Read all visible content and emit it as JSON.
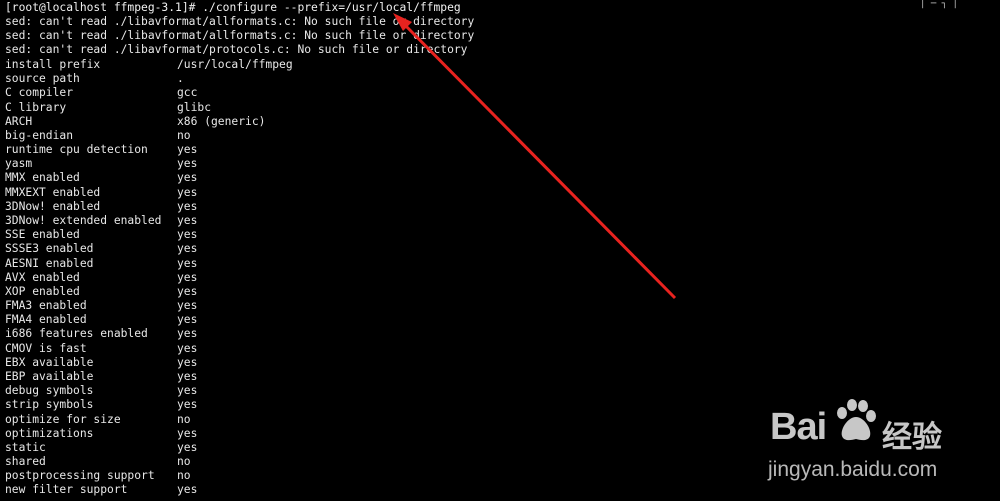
{
  "terminal": {
    "command_line": "[root@localhost ffmpeg-3.1]# ./configure --prefix=/usr/local/ffmpeg",
    "errors": [
      "sed: can't read ./libavformat/allformats.c: No such file or directory",
      "sed: can't read ./libavformat/allformats.c: No such file or directory",
      "sed: can't read ./libavformat/protocols.c: No such file or directory"
    ],
    "config": [
      {
        "key": "install prefix",
        "value": "/usr/local/ffmpeg"
      },
      {
        "key": "source path",
        "value": "."
      },
      {
        "key": "C compiler",
        "value": "gcc"
      },
      {
        "key": "C library",
        "value": "glibc"
      },
      {
        "key": "ARCH",
        "value": "x86 (generic)"
      },
      {
        "key": "big-endian",
        "value": "no"
      },
      {
        "key": "runtime cpu detection",
        "value": "yes"
      },
      {
        "key": "yasm",
        "value": "yes"
      },
      {
        "key": "MMX enabled",
        "value": "yes"
      },
      {
        "key": "MMXEXT enabled",
        "value": "yes"
      },
      {
        "key": "3DNow! enabled",
        "value": "yes"
      },
      {
        "key": "3DNow! extended enabled",
        "value": "yes"
      },
      {
        "key": "SSE enabled",
        "value": "yes"
      },
      {
        "key": "SSSE3 enabled",
        "value": "yes"
      },
      {
        "key": "AESNI enabled",
        "value": "yes"
      },
      {
        "key": "AVX enabled",
        "value": "yes"
      },
      {
        "key": "XOP enabled",
        "value": "yes"
      },
      {
        "key": "FMA3 enabled",
        "value": "yes"
      },
      {
        "key": "FMA4 enabled",
        "value": "yes"
      },
      {
        "key": "i686 features enabled",
        "value": "yes"
      },
      {
        "key": "CMOV is fast",
        "value": "yes"
      },
      {
        "key": "EBX available",
        "value": "yes"
      },
      {
        "key": "EBP available",
        "value": "yes"
      },
      {
        "key": "debug symbols",
        "value": "yes"
      },
      {
        "key": "strip symbols",
        "value": "yes"
      },
      {
        "key": "optimize for size",
        "value": "no"
      },
      {
        "key": "optimizations",
        "value": "yes"
      },
      {
        "key": "static",
        "value": "yes"
      },
      {
        "key": "shared",
        "value": "no"
      },
      {
        "key": "postprocessing support",
        "value": "no"
      },
      {
        "key": "new filter support",
        "value": "yes"
      }
    ],
    "text_color": "#e8e8e8",
    "background_color": "#000000"
  },
  "annotation": {
    "type": "red-arrow-icon",
    "color": "#e8231f"
  },
  "watermark": {
    "brand_text": "Bai",
    "paw_icon": "baidu-paw-icon",
    "suffix_text": "经验",
    "url": "jingyan.baidu.com"
  }
}
